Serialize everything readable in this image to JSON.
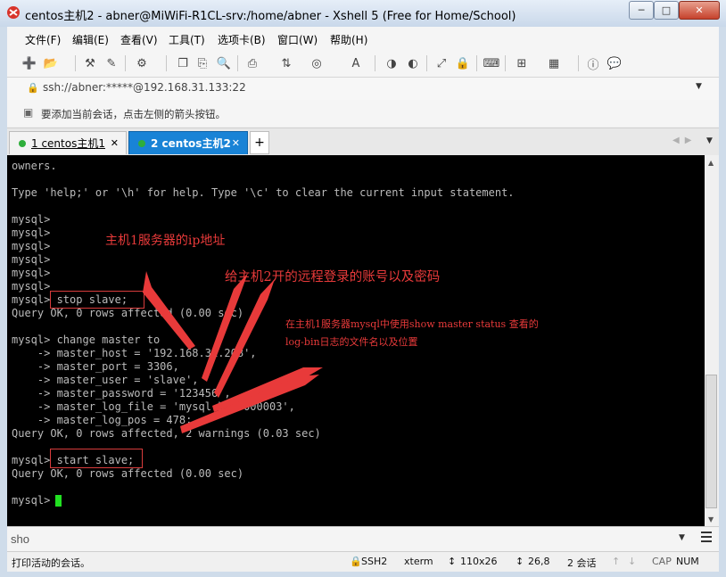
{
  "window": {
    "title": "centos主机2 - abner@MiWiFi-R1CL-srv:/home/abner - Xshell 5 (Free for Home/School)",
    "min_label": "─",
    "max_label": "□",
    "close_label": "✕"
  },
  "menu": [
    "文件(F)",
    "编辑(E)",
    "查看(V)",
    "工具(T)",
    "选项卡(B)",
    "窗口(W)",
    "帮助(H)"
  ],
  "address": {
    "text": "ssh://abner:*****@192.168.31.133:22"
  },
  "hint": {
    "text": "要添加当前会话，点击左侧的箭头按钮。"
  },
  "tabs": [
    {
      "label": "1 centos主机1",
      "dot_color": "#2eae3b",
      "active": false
    },
    {
      "label": "2 centos主机2",
      "dot_color": "#2eae3b",
      "active": true
    }
  ],
  "terminal": {
    "lines": [
      "owners.",
      "",
      "Type 'help;' or '\\h' for help. Type '\\c' to clear the current input statement.",
      "",
      "mysql>",
      "mysql>",
      "mysql>",
      "mysql>",
      "mysql>",
      "mysql>",
      "mysql> stop slave;",
      "Query OK, 0 rows affected (0.00 sec)",
      "",
      "mysql> change master to",
      "    -> master_host = '192.168.31.208',",
      "    -> master_port = 3306,",
      "    -> master_user = 'slave',",
      "    -> master_password = '123456',",
      "    -> master_log_file = 'mysql-bin.000003',",
      "    -> master_log_pos = 478;",
      "Query OK, 0 rows affected, 2 warnings (0.03 sec)",
      "",
      "mysql> start slave;",
      "Query OK, 0 rows affected (0.00 sec)",
      "",
      "mysql> "
    ],
    "background": "#000000",
    "text_color": "#bbbbbb",
    "cursor_color": "#21e021"
  },
  "annotations": {
    "label1": "主机1服务器的ip地址",
    "label2": "给主机2开的远程登录的账号以及密码",
    "label3_line1": "在主机1服务器mysql中使用show master status 查看的",
    "label3_line2": "log-bin日志的文件名以及位置",
    "color": "#e83a3a"
  },
  "compose": {
    "value": "sho"
  },
  "status": {
    "left": "打印活动的会话。",
    "protocol": "SSH2",
    "terminal_type": "xterm",
    "size": "110x26",
    "cursor_pos": "26,8",
    "sessions": "2 会话",
    "cap": "CAP",
    "num": "NUM"
  }
}
